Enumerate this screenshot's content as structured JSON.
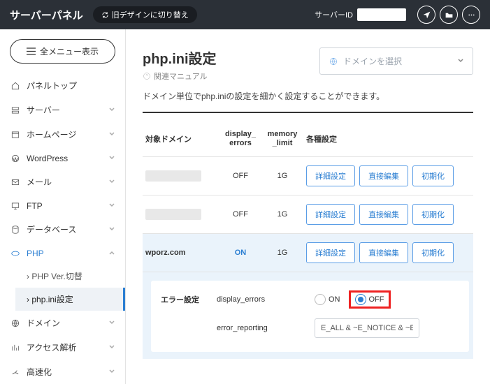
{
  "header": {
    "brand": "サーバーパネル",
    "old_design": "旧デザインに切り替え",
    "server_id_label": "サーバーID",
    "server_id_value": ""
  },
  "sidebar": {
    "all_menu": "全メニュー表示",
    "items": [
      {
        "label": "パネルトップ",
        "expandable": false
      },
      {
        "label": "サーバー",
        "expandable": true
      },
      {
        "label": "ホームページ",
        "expandable": true
      },
      {
        "label": "WordPress",
        "expandable": true
      },
      {
        "label": "メール",
        "expandable": true
      },
      {
        "label": "FTP",
        "expandable": true
      },
      {
        "label": "データベース",
        "expandable": true
      },
      {
        "label": "PHP",
        "expandable": true
      },
      {
        "label": "ドメイン",
        "expandable": true
      },
      {
        "label": "アクセス解析",
        "expandable": true
      },
      {
        "label": "高速化",
        "expandable": true
      }
    ],
    "php_sub": [
      {
        "label": "PHP Ver.切替"
      },
      {
        "label": "php.ini設定"
      }
    ]
  },
  "main": {
    "title": "php.ini設定",
    "manual": "関連マニュアル",
    "domain_placeholder": "ドメインを選択",
    "description": "ドメイン単位でphp.iniの設定を細かく設定することができます。",
    "columns": {
      "domain": "対象ドメイン",
      "display_errors": "display_errors",
      "memory_limit": "memory_limit",
      "settings": "各種設定"
    },
    "rows": [
      {
        "domain": "",
        "display_errors": "OFF",
        "memory_limit": "1G"
      },
      {
        "domain": "",
        "display_errors": "OFF",
        "memory_limit": "1G"
      },
      {
        "domain": "wporz.com",
        "display_errors": "ON",
        "memory_limit": "1G"
      }
    ],
    "actions": {
      "detail": "詳細設定",
      "edit": "直接編集",
      "reset": "初期化"
    },
    "inner": {
      "section": "エラー設定",
      "display_errors_key": "display_errors",
      "on": "ON",
      "off": "OFF",
      "error_reporting_key": "error_reporting",
      "error_reporting_value": "E_ALL & ~E_NOTICE & ~E"
    }
  }
}
